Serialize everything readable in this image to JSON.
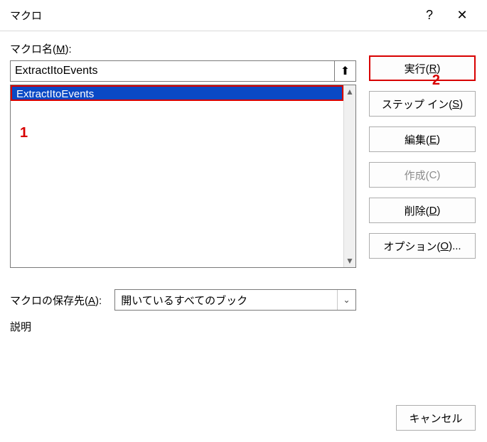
{
  "titlebar": {
    "title": "マクロ",
    "help": "?",
    "close": "✕"
  },
  "labels": {
    "macro_name_pre": "マクロ名(",
    "macro_name_u": "M",
    "macro_name_post": "):",
    "save_loc_pre": "マクロの保存先(",
    "save_loc_u": "A",
    "save_loc_post": "):",
    "description": "説明"
  },
  "name_input": {
    "value": "ExtractItoEvents"
  },
  "arrow_icon": "⬆",
  "list": {
    "items": [
      "ExtractItoEvents"
    ]
  },
  "annotations": {
    "a1": "1",
    "a2": "2"
  },
  "buttons": {
    "run_pre": "実行(",
    "run_u": "R",
    "run_post": ")",
    "step_pre": "ステップ イン(",
    "step_u": "S",
    "step_post": ")",
    "edit_pre": "編集(",
    "edit_u": "E",
    "edit_post": ")",
    "create_pre": "作成(",
    "create_u": "C",
    "create_post": ")",
    "delete_pre": "削除(",
    "delete_u": "D",
    "delete_post": ")",
    "options_pre": "オプション(",
    "options_u": "O",
    "options_post": ")...",
    "cancel": "キャンセル"
  },
  "save_location": {
    "selected": "開いているすべてのブック",
    "chev": "⌄"
  },
  "scroll": {
    "up": "▲",
    "down": "▼"
  }
}
